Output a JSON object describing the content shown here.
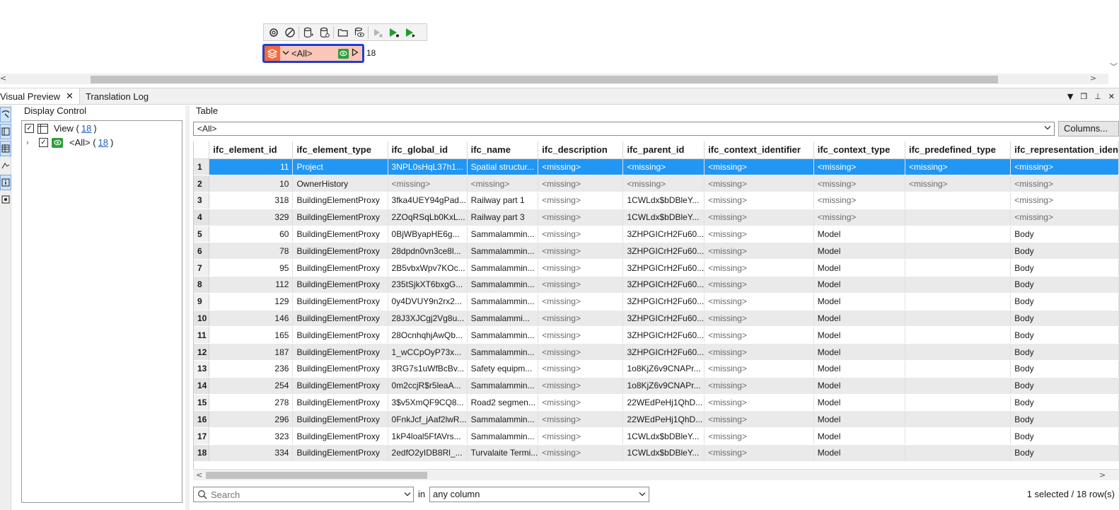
{
  "canvas": {
    "toolbar_buttons": [
      {
        "icon": "settings-icon"
      },
      {
        "icon": "disable-icon"
      },
      {
        "icon": "add-reader-icon"
      },
      {
        "icon": "reader-settings-icon"
      },
      {
        "icon": "open-folder-icon"
      },
      {
        "icon": "inspect-icon"
      },
      {
        "icon": "run-to-selected-icon"
      },
      {
        "icon": "run-icon"
      },
      {
        "icon": "run-from-selected-icon"
      }
    ],
    "node": {
      "label": "<All>",
      "count": "18",
      "accent": "#1f3fd1",
      "fill": "#f9c6b8"
    }
  },
  "tabs": [
    {
      "label": "Visual Preview",
      "close": "✕"
    },
    {
      "label": "Translation Log"
    }
  ],
  "display_control": {
    "title": "Display Control",
    "view": {
      "label": "View (",
      "count": "18",
      "suffix": ")"
    },
    "all": {
      "label": "<All> (",
      "count": "18",
      "suffix": ")"
    }
  },
  "table_panel": {
    "title": "Table",
    "filter_value": "<All>",
    "columns_button": "Columns...",
    "headers": [
      "ifc_element_id",
      "ifc_element_type",
      "ifc_global_id",
      "ifc_name",
      "ifc_description",
      "ifc_parent_id",
      "ifc_context_identifier",
      "ifc_context_type",
      "ifc_predefined_type",
      "ifc_representation_iden"
    ],
    "rows": [
      [
        "1",
        "11",
        "Project",
        "3NPL0sHqL37h1...",
        "Spatial structur...",
        "<missing>",
        "<missing>",
        "<missing>",
        "<missing>",
        "<missing>",
        "<missing>"
      ],
      [
        "2",
        "10",
        "OwnerHistory",
        "<missing>",
        "<missing>",
        "<missing>",
        "<missing>",
        "<missing>",
        "<missing>",
        "<missing>",
        "<missing>"
      ],
      [
        "3",
        "318",
        "BuildingElementProxy",
        "3fka4UEY94gPad...",
        "Railway part 1",
        "<missing>",
        "1CWLdx$bDBleY...",
        "<missing>",
        "<missing>",
        "",
        "<missing>"
      ],
      [
        "4",
        "329",
        "BuildingElementProxy",
        "2ZOqRSqLb0KxL...",
        "Railway part 3",
        "<missing>",
        "1CWLdx$bDBleY...",
        "<missing>",
        "<missing>",
        "",
        "<missing>"
      ],
      [
        "5",
        "60",
        "BuildingElementProxy",
        "0BjWByapHE6g...",
        "Sammalammin...",
        "<missing>",
        "3ZHPGICrH2Fu60...",
        "<missing>",
        "Model",
        "",
        "Body"
      ],
      [
        "6",
        "78",
        "BuildingElementProxy",
        "28dpdn0vn3ce8l...",
        "Sammalammin...",
        "<missing>",
        "3ZHPGICrH2Fu60...",
        "<missing>",
        "Model",
        "",
        "Body"
      ],
      [
        "7",
        "95",
        "BuildingElementProxy",
        "2B5vbxWpv7KOc...",
        "Sammalammin...",
        "<missing>",
        "3ZHPGICrH2Fu60...",
        "<missing>",
        "Model",
        "",
        "Body"
      ],
      [
        "8",
        "112",
        "BuildingElementProxy",
        "235tSjkXT6bxgG...",
        "Sammalammin...",
        "<missing>",
        "3ZHPGICrH2Fu60...",
        "<missing>",
        "Model",
        "",
        "Body"
      ],
      [
        "9",
        "129",
        "BuildingElementProxy",
        "0y4DVUY9n2rx2...",
        "Sammalammin...",
        "<missing>",
        "3ZHPGICrH2Fu60...",
        "<missing>",
        "Model",
        "",
        "Body"
      ],
      [
        "10",
        "146",
        "BuildingElementProxy",
        "28J3XJCgj2Vg8u...",
        "Sammalammi...",
        "<missing>",
        "3ZHPGICrH2Fu60...",
        "<missing>",
        "Model",
        "",
        "Body"
      ],
      [
        "11",
        "165",
        "BuildingElementProxy",
        "28OcnhqhjAwQb...",
        "Sammalammin...",
        "<missing>",
        "3ZHPGICrH2Fu60...",
        "<missing>",
        "Model",
        "",
        "Body"
      ],
      [
        "12",
        "187",
        "BuildingElementProxy",
        "1_wCCpOyP73x...",
        "Sammalammin...",
        "<missing>",
        "3ZHPGICrH2Fu60...",
        "<missing>",
        "Model",
        "",
        "Body"
      ],
      [
        "13",
        "236",
        "BuildingElementProxy",
        "3RG7s1uWfBcBv...",
        "Safety equipm...",
        "<missing>",
        "1o8KjZ6v9CNAPr...",
        "<missing>",
        "Model",
        "",
        "Body"
      ],
      [
        "14",
        "254",
        "BuildingElementProxy",
        "0m2ccjR$r5leaA...",
        "Sammalammin...",
        "<missing>",
        "1o8KjZ6v9CNAPr...",
        "<missing>",
        "Model",
        "",
        "Body"
      ],
      [
        "15",
        "278",
        "BuildingElementProxy",
        "3$v5XmQF9CQ8...",
        "Road2 segmen...",
        "<missing>",
        "22WEdPeHj1QhD...",
        "<missing>",
        "Model",
        "",
        "Body"
      ],
      [
        "16",
        "296",
        "BuildingElementProxy",
        "0FnkJcf_jAaf2lwR...",
        "Sammalammin...",
        "<missing>",
        "22WEdPeHj1QhD...",
        "<missing>",
        "Model",
        "",
        "Body"
      ],
      [
        "17",
        "323",
        "BuildingElementProxy",
        "1kP4loal5FfAVrs...",
        "Sammalammin...",
        "<missing>",
        "1CWLdx$bDBleY...",
        "<missing>",
        "Model",
        "",
        "Body"
      ],
      [
        "18",
        "334",
        "BuildingElementProxy",
        "2edfO2yIDB8Rl_...",
        "Turvalaite Termi...",
        "<missing>",
        "1CWLdx$bDBleY...",
        "<missing>",
        "Model",
        "",
        "Body"
      ]
    ],
    "selected_row": 0,
    "selection_color": "#2196f3",
    "search_placeholder": "Search",
    "in_label": "in",
    "column_scope": "any column",
    "status": "1 selected / 18 row(s)"
  }
}
